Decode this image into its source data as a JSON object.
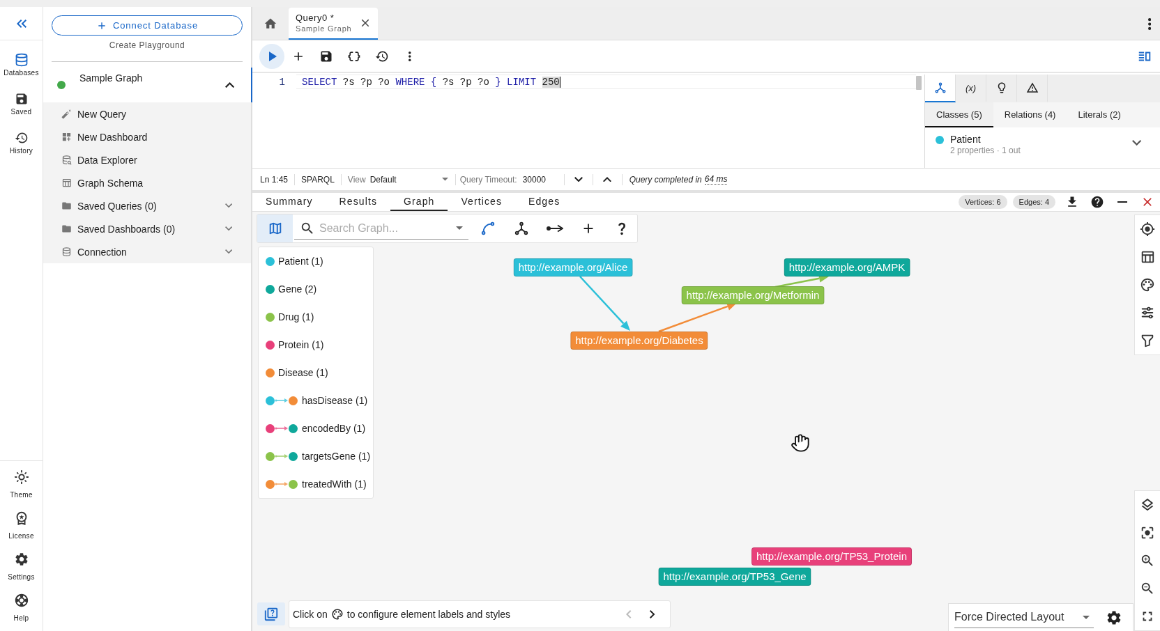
{
  "rail": {
    "top": [
      {
        "label": "Databases",
        "selected": true
      },
      {
        "label": "Saved",
        "selected": false
      },
      {
        "label": "History",
        "selected": false
      }
    ],
    "bottom": [
      {
        "label": "Theme"
      },
      {
        "label": "License"
      },
      {
        "label": "Settings"
      },
      {
        "label": "Help"
      }
    ]
  },
  "connections": {
    "connect_button": "Connect Database",
    "playground_link": "Create Playground",
    "database": {
      "name": "Sample Graph",
      "connected": true,
      "selected": true,
      "expanded": true
    },
    "items": [
      {
        "label": "New Query",
        "kind": "action"
      },
      {
        "label": "New Dashboard",
        "kind": "action"
      },
      {
        "label": "Data Explorer",
        "kind": "action"
      },
      {
        "label": "Graph Schema",
        "kind": "action"
      },
      {
        "label": "Saved Queries (0)",
        "kind": "group",
        "expanded": false
      },
      {
        "label": "Saved Dashboards (0)",
        "kind": "group",
        "expanded": false
      },
      {
        "label": "Connection",
        "kind": "group",
        "expanded": false
      }
    ]
  },
  "query_tabs": [
    {
      "title": "Query0 *",
      "subtitle": "Sample Graph",
      "selected": true
    }
  ],
  "editor": {
    "lines": [
      {
        "number": "1",
        "tokens": [
          {
            "text": "SELECT ",
            "kind": "keyword"
          },
          {
            "text": "?s ?p ?o ",
            "kind": "variable"
          },
          {
            "text": "WHERE { ",
            "kind": "keyword"
          },
          {
            "text": "?s ?p ?o ",
            "kind": "variable"
          },
          {
            "text": "} LIMIT ",
            "kind": "keyword"
          },
          {
            "text": "250",
            "kind": "number",
            "selected": true
          }
        ]
      }
    ]
  },
  "inspector": {
    "tabs": [
      {
        "kind": "icon",
        "selected": true
      },
      {
        "kind": "text",
        "label": "(x)",
        "selected": false
      },
      {
        "kind": "icon",
        "selected": false
      },
      {
        "kind": "icon",
        "selected": false
      }
    ],
    "sub_tabs": [
      {
        "label": "Classes (5)",
        "selected": true
      },
      {
        "label": "Relations (4)",
        "selected": false
      },
      {
        "label": "Literals (2)",
        "selected": false
      }
    ],
    "classes": [
      {
        "name": "Patient",
        "detail": "2 properties · 1 out",
        "color": "#2bc0d8",
        "expanded": false
      }
    ]
  },
  "status_bar": {
    "position": "Ln 1:45",
    "language": "SPARQL",
    "view_label": "View",
    "view_value": "Default",
    "timeout_label": "Query Timeout:",
    "timeout_value": "30000",
    "message": "Query completed in",
    "duration": "64 ms"
  },
  "result_tabs": [
    {
      "label": "Summary",
      "selected": false
    },
    {
      "label": "Results",
      "selected": false
    },
    {
      "label": "Graph",
      "selected": true
    },
    {
      "label": "Vertices",
      "selected": false
    },
    {
      "label": "Edges",
      "selected": false
    }
  ],
  "counters": [
    "Vertices: 6",
    "Edges: 4"
  ],
  "graph": {
    "legend_toggle": {
      "selected": true
    },
    "search": {
      "placeholder": "Search Graph..."
    },
    "legend": [
      {
        "kind": "class",
        "label": "Patient (1)",
        "color": "#2bc0d8"
      },
      {
        "kind": "class",
        "label": "Gene (2)",
        "color": "#0fa89b"
      },
      {
        "kind": "class",
        "label": "Drug (1)",
        "color": "#8bc34a"
      },
      {
        "kind": "class",
        "label": "Protein (1)",
        "color": "#e8407a"
      },
      {
        "kind": "class",
        "label": "Disease (1)",
        "color": "#f28c38"
      },
      {
        "kind": "relation",
        "label": "hasDisease (1)",
        "color": "#2bc0d8",
        "target": {
          "color": "#f28c38"
        }
      },
      {
        "kind": "relation",
        "label": "encodedBy (1)",
        "color": "#e8407a",
        "target": {
          "color": "#0fa89b"
        }
      },
      {
        "kind": "relation",
        "label": "targetsGene (1)",
        "color": "#8bc34a",
        "target": {
          "color": "#0fa89b"
        }
      },
      {
        "kind": "relation",
        "label": "treatedWith (1)",
        "color": "#f28c38",
        "target": {
          "color": "#8bc34a"
        }
      }
    ],
    "nodes": [
      {
        "label": "http://example.org/Alice",
        "color": "#2bc0d8"
      },
      {
        "label": "http://example.org/AMPK",
        "color": "#0fa89b"
      },
      {
        "label": "http://example.org/Metformin",
        "color": "#8bc34a"
      },
      {
        "label": "http://example.org/Diabetes",
        "color": "#f28c38"
      },
      {
        "label": "http://example.org/TP53_Protein",
        "color": "#e8407a"
      },
      {
        "label": "http://example.org/TP53_Gene",
        "color": "#0fa89b"
      }
    ],
    "tip": {
      "before": "Click on",
      "after": "to configure element labels and styles",
      "previous_disabled": true,
      "next_disabled": false
    },
    "layout": "Force Directed Layout"
  }
}
